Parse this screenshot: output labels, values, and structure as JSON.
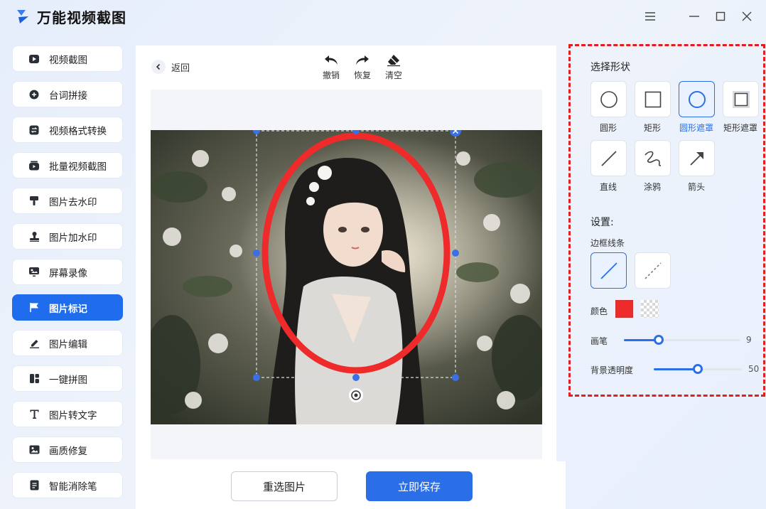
{
  "app": {
    "title": "万能视频截图"
  },
  "window": {
    "menu_icon": "menu-icon",
    "minimize_icon": "minimize-icon",
    "maximize_icon": "maximize-icon",
    "close_icon": "close-icon"
  },
  "sidebar": {
    "items": [
      {
        "label": "视频截图",
        "icon": "video-play-icon"
      },
      {
        "label": "台词拼接",
        "icon": "plus-circle-icon"
      },
      {
        "label": "视频格式转换",
        "icon": "swap-icon"
      },
      {
        "label": "批量视频截图",
        "icon": "batch-video-icon"
      },
      {
        "label": "图片去水印",
        "icon": "brush-icon"
      },
      {
        "label": "图片加水印",
        "icon": "stamp-icon"
      },
      {
        "label": "屏幕录像",
        "icon": "screen-record-icon"
      },
      {
        "label": "图片标记",
        "icon": "flag-icon",
        "active": true
      },
      {
        "label": "图片编辑",
        "icon": "edit-icon"
      },
      {
        "label": "一键拼图",
        "icon": "collage-icon"
      },
      {
        "label": "图片转文字",
        "icon": "text-t-icon"
      },
      {
        "label": "画质修复",
        "icon": "image-icon"
      },
      {
        "label": "智能消除笔",
        "icon": "document-icon"
      }
    ]
  },
  "toolbar": {
    "back_label": "返回",
    "undo_label": "撤销",
    "redo_label": "恢复",
    "clear_label": "清空"
  },
  "actions": {
    "reselect_label": "重选图片",
    "save_label": "立即保存"
  },
  "shape_panel": {
    "title": "选择形状",
    "shapes": [
      {
        "label": "圆形",
        "icon": "circle-icon"
      },
      {
        "label": "矩形",
        "icon": "square-icon"
      },
      {
        "label": "圆形遮罩",
        "icon": "circle-mask-icon",
        "active": true
      },
      {
        "label": "矩形遮罩",
        "icon": "rect-mask-icon"
      },
      {
        "label": "直线",
        "icon": "line-icon"
      },
      {
        "label": "涂鸦",
        "icon": "scribble-icon"
      },
      {
        "label": "箭头",
        "icon": "arrow-icon"
      }
    ]
  },
  "settings": {
    "title": "设置:",
    "border_label": "边框线条",
    "border_options": [
      {
        "name": "solid",
        "active": true
      },
      {
        "name": "dashed",
        "active": false
      }
    ],
    "color_label": "颜色",
    "color_value": "#ee2a2a",
    "pen_label": "画笔",
    "pen_value": "9",
    "pen_fraction": 0.3,
    "opacity_label": "背景透明度",
    "opacity_value": "50",
    "opacity_fraction": 0.5
  },
  "colors": {
    "accent": "#2b6fe8",
    "active_nav": "#1f6cec",
    "highlight_border": "#e21f1f"
  }
}
